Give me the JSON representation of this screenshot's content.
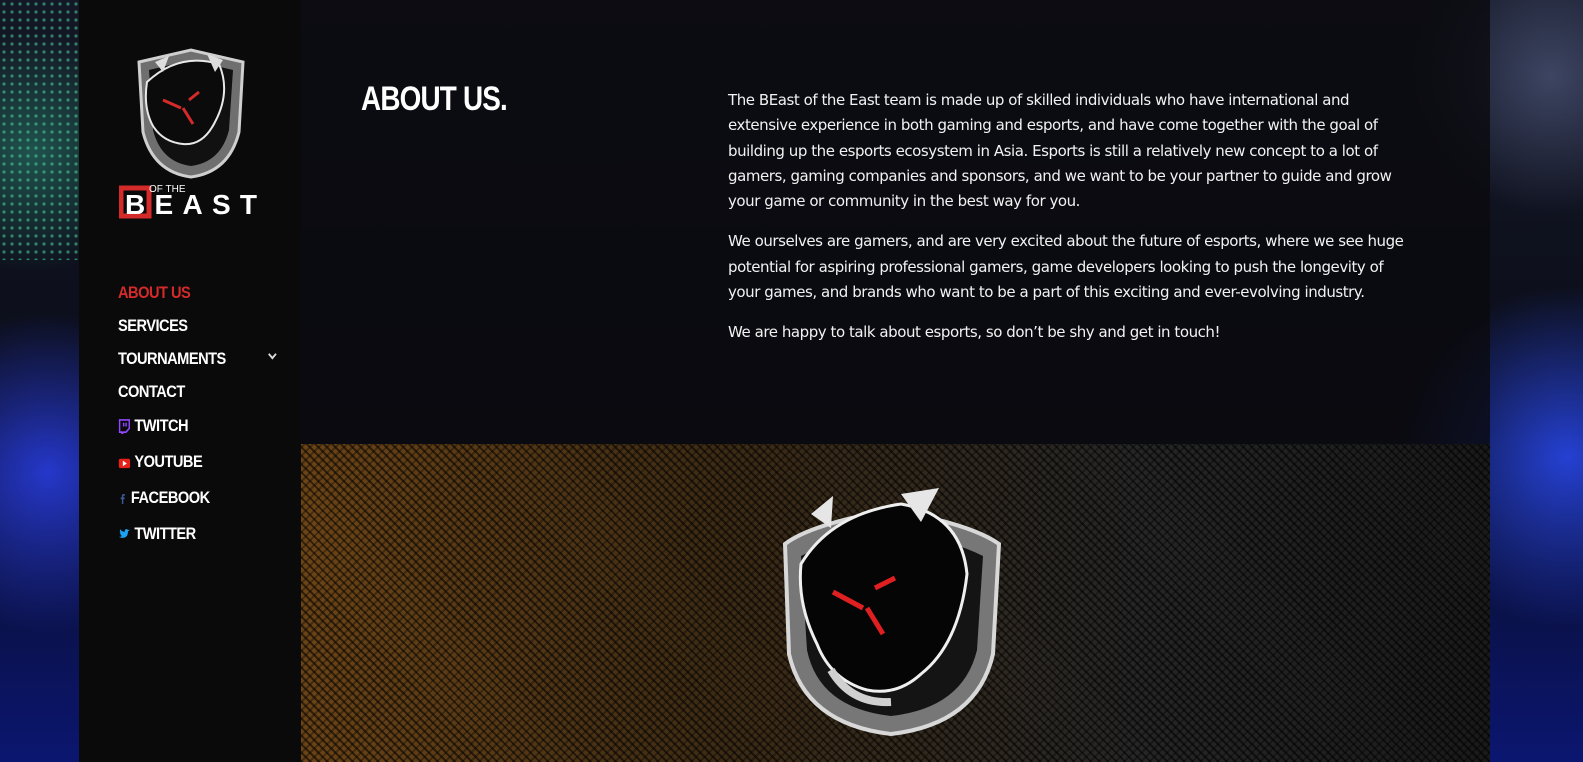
{
  "brand": {
    "logo_text": "BEAST",
    "logo_small_text": "OF THE"
  },
  "nav": {
    "items": [
      {
        "label": "ABOUT US"
      },
      {
        "label": "SERVICES"
      },
      {
        "label": "TOURNAMENTS"
      },
      {
        "label": "CONTACT"
      }
    ],
    "social": [
      {
        "label": "TWITCH",
        "icon": "twitch-icon",
        "color": "#9146ff"
      },
      {
        "label": "YOUTUBE",
        "icon": "youtube-icon",
        "color": "#e62117"
      },
      {
        "label": "FACEBOOK",
        "icon": "facebook-icon",
        "color": "#3b5998"
      },
      {
        "label": "TWITTER",
        "icon": "twitter-icon",
        "color": "#1da1f2"
      }
    ]
  },
  "about": {
    "title": "ABOUT US.",
    "paragraphs": [
      "The BEast of the East team is made up of skilled individuals who have international and extensive experience in both gaming and esports, and have come together with the goal of building up the esports ecosystem in Asia. Esports is still a relatively new concept to a lot of gamers, gaming companies and sponsors, and we want to be your partner to guide and grow your game or community in the best way for you.",
      "We ourselves are gamers, and are very excited about the future of esports, where we see huge potential for aspiring professional gamers, game developers looking to push the longevity of your games, and brands who want to be a part of this exciting and ever-evolving industry.",
      "We are happy to talk about esports, so don’t be shy and get in touch!"
    ]
  },
  "colors": {
    "accent": "#d42a2a",
    "sidebar_bg": "#0a0a0a"
  }
}
